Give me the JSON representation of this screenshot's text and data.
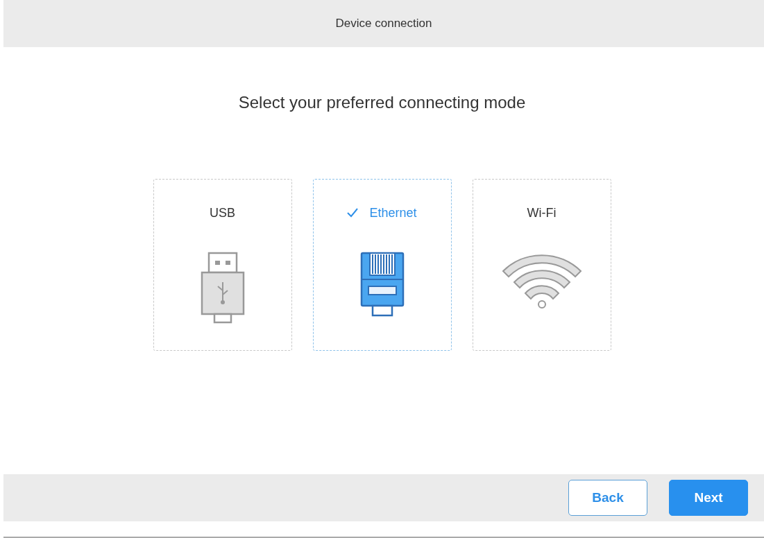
{
  "header": {
    "title": "Device connection"
  },
  "heading": "Select your preferred connecting mode",
  "modes": [
    {
      "label": "USB",
      "kind": "usb",
      "selected": false
    },
    {
      "label": "Ethernet",
      "kind": "ethernet",
      "selected": true
    },
    {
      "label": "Wi-Fi",
      "kind": "wifi",
      "selected": false
    }
  ],
  "buttons": [
    {
      "label": "Back",
      "kind": "secondary"
    },
    {
      "label": "Next",
      "kind": "primary"
    }
  ]
}
